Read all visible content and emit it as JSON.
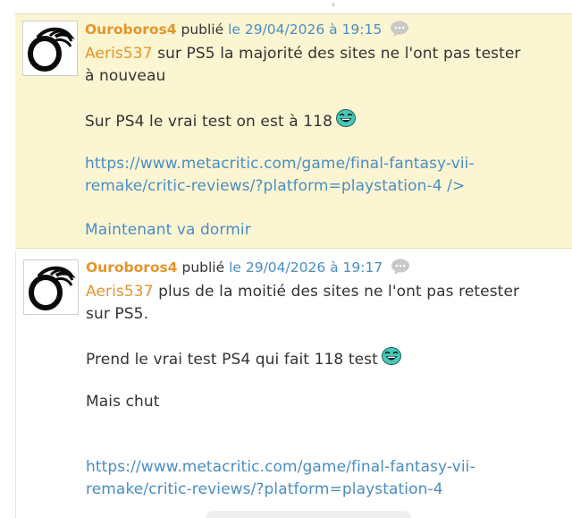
{
  "posts": [
    {
      "author": "Ouroboros4",
      "published_word": "publié",
      "date": "le 29/04/2026 à 19:15",
      "lines": [
        {
          "mention": "Aeris537",
          "text": " sur PS5 la majorité des sites ne l'ont pas tester"
        },
        {
          "text": "à nouveau"
        },
        {
          "gap": true
        },
        {
          "text": "Sur PS4 le vrai test on est à 118",
          "smiley": true
        },
        {
          "gap": true
        },
        {
          "link": "https://www.metacritic.com/game/final-fantasy-vii-"
        },
        {
          "link": "remake/critic-reviews/?platform=playstation-4 />"
        },
        {
          "gap": true
        },
        {
          "link": "Maintenant va dormir"
        }
      ]
    },
    {
      "author": "Ouroboros4",
      "published_word": "publié",
      "date": "le 29/04/2026 à 19:17",
      "lines": [
        {
          "mention": "Aeris537",
          "text": " plus de la moitié des sites ne l'ont pas retester"
        },
        {
          "text": "sur PS5."
        },
        {
          "gap": true
        },
        {
          "text": "Prend le vrai test PS4 qui fait 118 test",
          "smiley": true
        },
        {
          "gap": true
        },
        {
          "text": "Mais chut"
        },
        {
          "gap": true
        },
        {
          "gap": true
        },
        {
          "link": "https://www.metacritic.com/game/final-fantasy-vii-"
        },
        {
          "link": "remake/critic-reviews/?platform=playstation-4"
        }
      ]
    }
  ],
  "colors": {
    "author": "#e4952c",
    "date_link": "#4a8dc5",
    "highlight_bg": "#fcf5d2",
    "text": "#333333"
  },
  "icons": {
    "quote": "speech-bubble-icon",
    "smiley": "laughing-smiley-icon",
    "avatar": "ouroboros-avatar"
  }
}
